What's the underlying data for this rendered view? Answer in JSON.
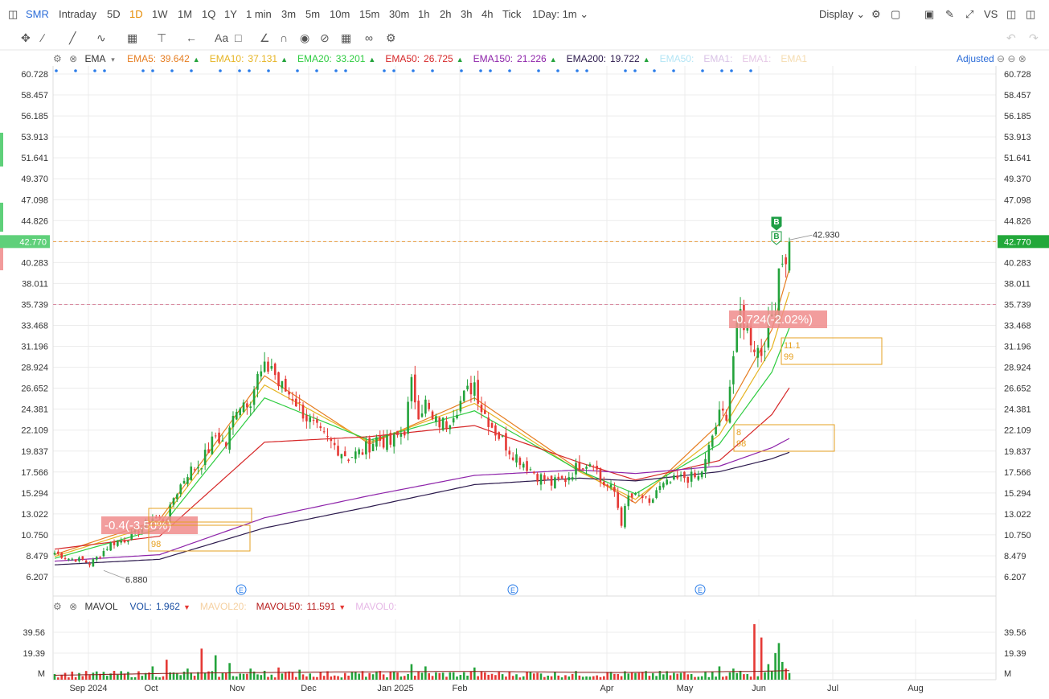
{
  "toolbar": {
    "symbol": "SMR",
    "periods": [
      "Intraday",
      "5D",
      "1D",
      "1W",
      "1M",
      "1Q",
      "1Y",
      "1 min",
      "3m",
      "5m",
      "10m",
      "15m",
      "30m",
      "1h",
      "2h",
      "3h",
      "4h",
      "Tick"
    ],
    "active_period": "1D",
    "range": "1Day: 1m",
    "display": "Display",
    "vs": "VS"
  },
  "main_legend": {
    "name": "EMA",
    "items": [
      {
        "label": "EMA5:",
        "value": "39.642",
        "color": "#e67e22",
        "arrow": "up"
      },
      {
        "label": "EMA10:",
        "value": "37.131",
        "color": "#e6b422",
        "arrow": "up"
      },
      {
        "label": "EMA20:",
        "value": "33.201",
        "color": "#2ecc40",
        "arrow": "up"
      },
      {
        "label": "EMA50:",
        "value": "26.725",
        "color": "#d62728",
        "arrow": "up"
      },
      {
        "label": "EMA150:",
        "value": "21.226",
        "color": "#8e24aa",
        "arrow": "up"
      },
      {
        "label": "EMA200:",
        "value": "19.722",
        "color": "#2c1a4d",
        "arrow": "up"
      },
      {
        "label": "EMA50:",
        "value": "",
        "color": "#b3e5f5",
        "arrow": ""
      },
      {
        "label": "EMA1:",
        "value": "",
        "color": "#d9c2e6",
        "arrow": ""
      },
      {
        "label": "EMA1:",
        "value": "",
        "color": "#e6c8e6",
        "arrow": ""
      },
      {
        "label": "EMA1",
        "value": "",
        "color": "#f5dcb0",
        "arrow": ""
      }
    ],
    "adjusted": "Adjusted"
  },
  "vol_legend": {
    "name": "MAVOL",
    "items": [
      {
        "label": "VOL:",
        "value": "1.962",
        "color": "#1a4fa3",
        "arrow": "down"
      },
      {
        "label": "MAVOL20:",
        "value": "",
        "color": "#f5d0a0",
        "arrow": ""
      },
      {
        "label": "MAVOL50:",
        "value": "11.591",
        "color": "#b71c1c",
        "arrow": "down"
      },
      {
        "label": "MAVOL0:",
        "value": "",
        "color": "#e6b8e6",
        "arrow": ""
      }
    ]
  },
  "annotations": {
    "high_label": "42.930",
    "low_label": "6.880",
    "price_badge": "42.770",
    "pct_box_1": "-0.724(-2.02%)",
    "pct_box_2": "-0.4(-3.50%)",
    "box_a": [
      "11.1",
      "99"
    ],
    "box_b": [
      "8",
      "98"
    ],
    "box_c": [
      "98"
    ],
    "marker_b": "B",
    "event": "E"
  },
  "colors": {
    "up": "#23a33b",
    "down": "#e53935",
    "grid": "#ececec"
  },
  "chart_data": [
    {
      "type": "candlestick",
      "x_tick_labels": [
        "Sep 2024",
        "Oct",
        "Nov",
        "Dec",
        "Jan 2025",
        "Feb",
        "Apr",
        "May",
        "Jun",
        "Jul",
        "Aug"
      ],
      "y_tick_labels": [
        "60.728",
        "58.457",
        "56.185",
        "53.913",
        "51.641",
        "49.370",
        "47.098",
        "44.826",
        "42.770",
        "40.283",
        "38.011",
        "35.739",
        "33.468",
        "31.196",
        "28.924",
        "26.652",
        "24.381",
        "22.109",
        "19.837",
        "17.566",
        "15.294",
        "13.022",
        "10.750",
        "8.479",
        "6.207"
      ],
      "ylim": [
        5.4,
        61.5
      ],
      "grid": true,
      "last_price": 42.77,
      "high": 42.93,
      "low": 6.88,
      "close_path": [
        [
          0,
          8.8
        ],
        [
          4,
          8.2
        ],
        [
          8,
          8.0
        ],
        [
          10,
          7.6
        ],
        [
          13,
          8.6
        ],
        [
          16,
          9.8
        ],
        [
          20,
          10.2
        ],
        [
          24,
          11.2
        ],
        [
          28,
          12.6
        ],
        [
          32,
          12.2
        ],
        [
          34,
          14.8
        ],
        [
          38,
          17.5
        ],
        [
          42,
          18.6
        ],
        [
          46,
          21.5
        ],
        [
          49,
          20.5
        ],
        [
          52,
          24.8
        ],
        [
          56,
          25.6
        ],
        [
          58,
          27.8
        ],
        [
          62,
          29.2
        ],
        [
          64,
          27.0
        ],
        [
          68,
          25.8
        ],
        [
          72,
          23.5
        ],
        [
          76,
          21.6
        ],
        [
          80,
          20.4
        ],
        [
          84,
          19.2
        ],
        [
          88,
          19.8
        ],
        [
          92,
          21.2
        ],
        [
          96,
          20.6
        ],
        [
          100,
          22.2
        ],
        [
          102,
          27.0
        ],
        [
          104,
          24.2
        ],
        [
          106,
          25.0
        ],
        [
          108,
          23.0
        ],
        [
          112,
          22.8
        ],
        [
          114,
          24.2
        ],
        [
          118,
          26.2
        ],
        [
          120,
          27.3
        ],
        [
          122,
          24.5
        ],
        [
          126,
          22.0
        ],
        [
          130,
          20.0
        ],
        [
          134,
          18.6
        ],
        [
          138,
          17.2
        ],
        [
          142,
          16.3
        ],
        [
          146,
          16.8
        ],
        [
          150,
          18.4
        ],
        [
          154,
          18.8
        ],
        [
          156,
          16.6
        ],
        [
          160,
          15.4
        ],
        [
          162,
          12.1
        ],
        [
          164,
          14.8
        ],
        [
          168,
          14.8
        ],
        [
          170,
          13.8
        ],
        [
          172,
          15.6
        ],
        [
          176,
          16.4
        ],
        [
          180,
          17.0
        ],
        [
          184,
          16.9
        ],
        [
          186,
          18.6
        ],
        [
          188,
          21.5
        ],
        [
          190,
          23.6
        ],
        [
          192,
          24.0
        ],
        [
          194,
          30.2
        ],
        [
          196,
          34.8
        ],
        [
          198,
          33.0
        ],
        [
          200,
          31.3
        ],
        [
          202,
          30.6
        ],
        [
          204,
          33.2
        ],
        [
          206,
          36.0
        ],
        [
          207,
          40.0
        ],
        [
          208,
          41.2
        ],
        [
          209,
          39.6
        ],
        [
          210,
          42.77
        ]
      ],
      "series": [
        {
          "name": "EMA5",
          "color": "#e67e22",
          "values": [
            [
              0,
              8.6
            ],
            [
              30,
              12.4
            ],
            [
              60,
              28.0
            ],
            [
              90,
              20.6
            ],
            [
              120,
              25.6
            ],
            [
              150,
              17.8
            ],
            [
              166,
              14.2
            ],
            [
              190,
              22.8
            ],
            [
              205,
              33.0
            ],
            [
              210,
              39.6
            ]
          ]
        },
        {
          "name": "EMA10",
          "color": "#e6b422",
          "values": [
            [
              0,
              8.4
            ],
            [
              30,
              12.0
            ],
            [
              60,
              27.0
            ],
            [
              90,
              20.8
            ],
            [
              120,
              25.0
            ],
            [
              150,
              17.6
            ],
            [
              166,
              14.6
            ],
            [
              190,
              21.6
            ],
            [
              205,
              31.0
            ],
            [
              210,
              37.1
            ]
          ]
        },
        {
          "name": "EMA20",
          "color": "#2ecc40",
          "values": [
            [
              0,
              8.2
            ],
            [
              30,
              11.4
            ],
            [
              60,
              25.6
            ],
            [
              90,
              21.0
            ],
            [
              120,
              24.2
            ],
            [
              150,
              17.7
            ],
            [
              166,
              15.2
            ],
            [
              190,
              20.6
            ],
            [
              205,
              28.4
            ],
            [
              210,
              33.2
            ]
          ]
        },
        {
          "name": "EMA50",
          "color": "#d62728",
          "values": [
            [
              0,
              9.2
            ],
            [
              30,
              10.6
            ],
            [
              60,
              20.8
            ],
            [
              90,
              21.4
            ],
            [
              120,
              22.6
            ],
            [
              150,
              18.6
            ],
            [
              166,
              16.7
            ],
            [
              190,
              18.8
            ],
            [
              205,
              23.8
            ],
            [
              210,
              26.7
            ]
          ]
        },
        {
          "name": "EMA150",
          "color": "#8e24aa",
          "values": [
            [
              0,
              7.9
            ],
            [
              30,
              8.6
            ],
            [
              60,
              12.6
            ],
            [
              90,
              15.0
            ],
            [
              120,
              17.2
            ],
            [
              150,
              17.8
            ],
            [
              166,
              17.4
            ],
            [
              190,
              18.2
            ],
            [
              205,
              20.2
            ],
            [
              210,
              21.2
            ]
          ]
        },
        {
          "name": "EMA200",
          "color": "#2c1a4d",
          "values": [
            [
              0,
              7.5
            ],
            [
              30,
              8.1
            ],
            [
              60,
              11.5
            ],
            [
              90,
              13.8
            ],
            [
              120,
              16.2
            ],
            [
              150,
              16.9
            ],
            [
              166,
              16.6
            ],
            [
              190,
              17.6
            ],
            [
              205,
              19.0
            ],
            [
              210,
              19.7
            ]
          ]
        }
      ]
    },
    {
      "type": "bar",
      "title": "MAVOL",
      "y_tick_labels": [
        "39.56",
        "19.39",
        "M"
      ],
      "ylim": [
        0,
        50
      ],
      "spikes": [
        [
          26,
          6
        ],
        [
          28,
          12
        ],
        [
          32,
          18
        ],
        [
          38,
          10
        ],
        [
          42,
          28
        ],
        [
          46,
          22
        ],
        [
          50,
          15
        ],
        [
          56,
          10
        ],
        [
          60,
          8
        ],
        [
          64,
          11
        ],
        [
          70,
          9
        ],
        [
          90,
          6
        ],
        [
          102,
          14
        ],
        [
          106,
          12
        ],
        [
          120,
          11
        ],
        [
          136,
          7
        ],
        [
          158,
          7
        ],
        [
          166,
          6
        ],
        [
          186,
          7
        ],
        [
          190,
          12
        ],
        [
          194,
          10
        ],
        [
          196,
          8
        ],
        [
          200,
          50
        ],
        [
          202,
          38
        ],
        [
          204,
          14
        ],
        [
          206,
          24
        ],
        [
          207,
          33
        ],
        [
          208,
          16
        ],
        [
          209,
          10
        ]
      ],
      "mavol50": [
        [
          0,
          4
        ],
        [
          40,
          6
        ],
        [
          80,
          7
        ],
        [
          120,
          7.5
        ],
        [
          160,
          6.5
        ],
        [
          200,
          7.5
        ],
        [
          210,
          8.2
        ]
      ]
    }
  ]
}
